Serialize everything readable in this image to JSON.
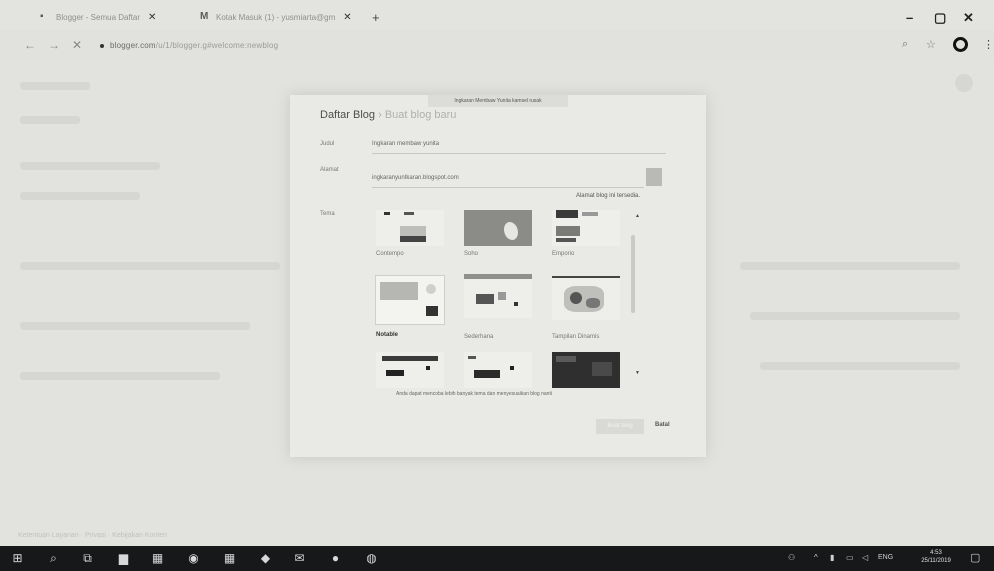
{
  "browser": {
    "tabs": [
      {
        "title": "Blogger - Semua Daftar",
        "icon": "blogger-icon"
      },
      {
        "title": "Kotak Masuk (1) - yusmiarta@gm",
        "icon": "gmail-icon"
      }
    ],
    "new_tab": "+",
    "window_controls": {
      "minimize": "–",
      "maximize": "▢",
      "close": "✕"
    },
    "nav": {
      "back": "←",
      "forward": "→",
      "stop": "✕"
    },
    "url_host": "blogger.com",
    "url_path": "/u/1/blogger.g#welcome:newblog",
    "address_icons": {
      "search": "⌕",
      "star": "☆",
      "menu": "⋮"
    }
  },
  "dialog": {
    "toast": "Ingkaran Membaw Yunita kamsel rusak",
    "title": "Daftar Blog",
    "breadcrumb_sep": "›",
    "breadcrumb_current": "Buat blog baru",
    "fields": {
      "title_label": "Judul",
      "title_value": "Ingkaran membaw yunita",
      "address_label": "Alamat",
      "address_value": "ingkaranyuntkaran.blogspot.com",
      "address_hint": "Alamat blog ini tersedia.",
      "theme_label": "Tema"
    },
    "themes": [
      {
        "name": "Contempo"
      },
      {
        "name": "Soho"
      },
      {
        "name": "Emporio"
      },
      {
        "name": "Notable"
      },
      {
        "name": "Sederhana"
      },
      {
        "name": "Tampilan Dinamis"
      },
      {
        "name": ""
      },
      {
        "name": ""
      },
      {
        "name": ""
      }
    ],
    "selected_theme": "Notable",
    "theme_note": "Anda dapat mencoba lebih banyak tema dan menyesuaikan blog nanti",
    "buttons": {
      "create": "Buat blog",
      "cancel": "Batal"
    }
  },
  "background": {
    "footer_text": "Ketentuan Layanan · Privasi · Kebijakan Konten"
  },
  "taskbar": {
    "tray": {
      "lang": "ENG",
      "chevron": "^",
      "people": "⚇"
    },
    "time": "4:53",
    "date": "25/11/2019"
  },
  "colors": {
    "taskbar": "#17181a",
    "dialog": "#e9e9e6",
    "page": "#e2e3df"
  }
}
